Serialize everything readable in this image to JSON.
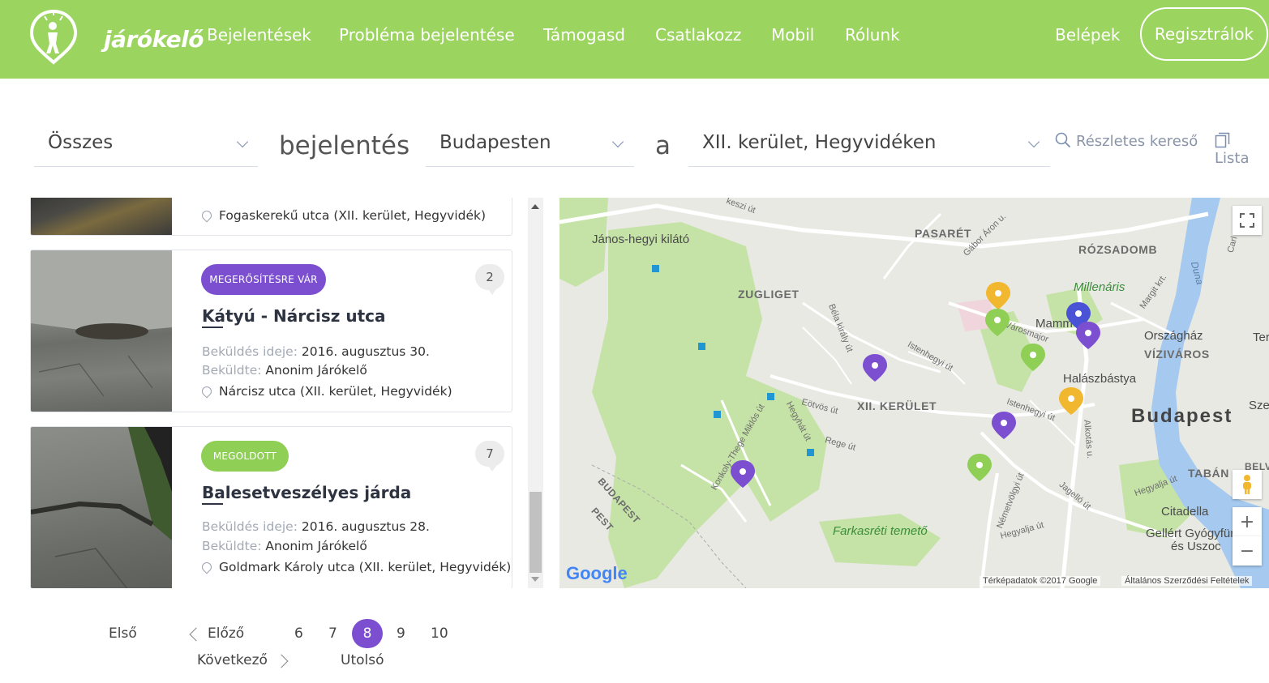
{
  "header": {
    "logo_text": "járókelő",
    "nav": [
      "Bejelentések",
      "Probléma bejelentése",
      "Támogasd",
      "Csatlakozz",
      "Mobil",
      "Rólunk"
    ],
    "login": "Belépek",
    "register": "Regisztrálok",
    "bg_color": "#9bd45f"
  },
  "filters": {
    "type": "Összes",
    "word1": "bejelentés",
    "city": "Budapesten",
    "word2": "a",
    "district": "XII. kerület, Hegyvidéken",
    "advanced_search": "Részletes kereső",
    "list_view": "Lista"
  },
  "reports": [
    {
      "location": "Fogaskerekű utca (XII. kerület, Hegyvidék)"
    },
    {
      "badge": "MEGERŐSÍTÉSRE VÁR",
      "badge_color": "#7c4fd1",
      "comments": "2",
      "title": "Kátyú - Nárcisz utca",
      "sent_label": "Beküldés ideje:",
      "sent_value": "2016. augusztus 30.",
      "by_label": "Beküldte:",
      "by_value": "Anonim Járókelő",
      "location": "Nárcisz utca (XII. kerület, Hegyvidék)"
    },
    {
      "badge": "MEGOLDOTT",
      "badge_color": "#8fcf55",
      "comments": "7",
      "title": "Balesetveszélyes járda",
      "sent_label": "Beküldés ideje:",
      "sent_value": "2016. augusztus 28.",
      "by_label": "Beküldte:",
      "by_value": "Anonim Járókelő",
      "location": "Goldmark Károly utca (XII. kerület, Hegyvidék)"
    }
  ],
  "map": {
    "labels": {
      "kilato": "János-hegyi kilátó",
      "pasaret": "PASARÉT",
      "rozsadomb": "RÓZSADOMB",
      "zugliget": "ZUGLIGET",
      "millenaris": "Millenáris",
      "mamm": "Mamm",
      "orszaghaz": "Országház",
      "vizivaros": "VÍZIVÁROS",
      "halaszbastya": "Halászbástya",
      "xii": "XII. KERÜLET",
      "budapest": "Budapest",
      "taban": "TABÁN",
      "citadella": "Citadella",
      "gellert1": "Gellért Gyógyfürd",
      "gellert2": "és Uszoc",
      "farkasreti": "Farkasréti temető",
      "budapest_pest1": "BUDAPEST",
      "budapest_pest2": "PEST",
      "ter": "Ter",
      "sze": "Sze",
      "bel": "BELV",
      "duna": "Duna",
      "gabor": "Gábor Áron u.",
      "bela": "Béla király út",
      "istenhegyi1": "Istenhegyi út",
      "istenhegyi2": "Istenhegyi út",
      "eotvos": "Eötvös út",
      "hegyhat": "Hegyhát út",
      "rege": "Rege út",
      "konkoly": "Konkoly-Thege Miklós út",
      "nemetvolgyi": "Németvölgyi út",
      "hegyalja1": "Hegyalja út",
      "hegyalja2": "Hegyalja út",
      "jagello": "Jagelló út",
      "alkotas": "Alkotás u.",
      "varosmajor": "Városmajor",
      "margit": "Margit krt.",
      "kesz": "keszi út",
      "carl": "Carl"
    },
    "google": "Google",
    "copyright": "Térképadatok ©2017 Google",
    "terms": "Általános Szerződési Feltételek",
    "zoom_in": "+",
    "zoom_out": "−",
    "pin_colors": {
      "purple": "#7c4fd1",
      "green": "#8fcf55",
      "yellow": "#f0b72f",
      "blue": "#4a52d6"
    }
  },
  "pagination": {
    "first": "Első",
    "prev": "Előző",
    "pages": [
      "6",
      "7",
      "8",
      "9",
      "10"
    ],
    "current": "8",
    "next": "Következő",
    "last": "Utolsó"
  }
}
